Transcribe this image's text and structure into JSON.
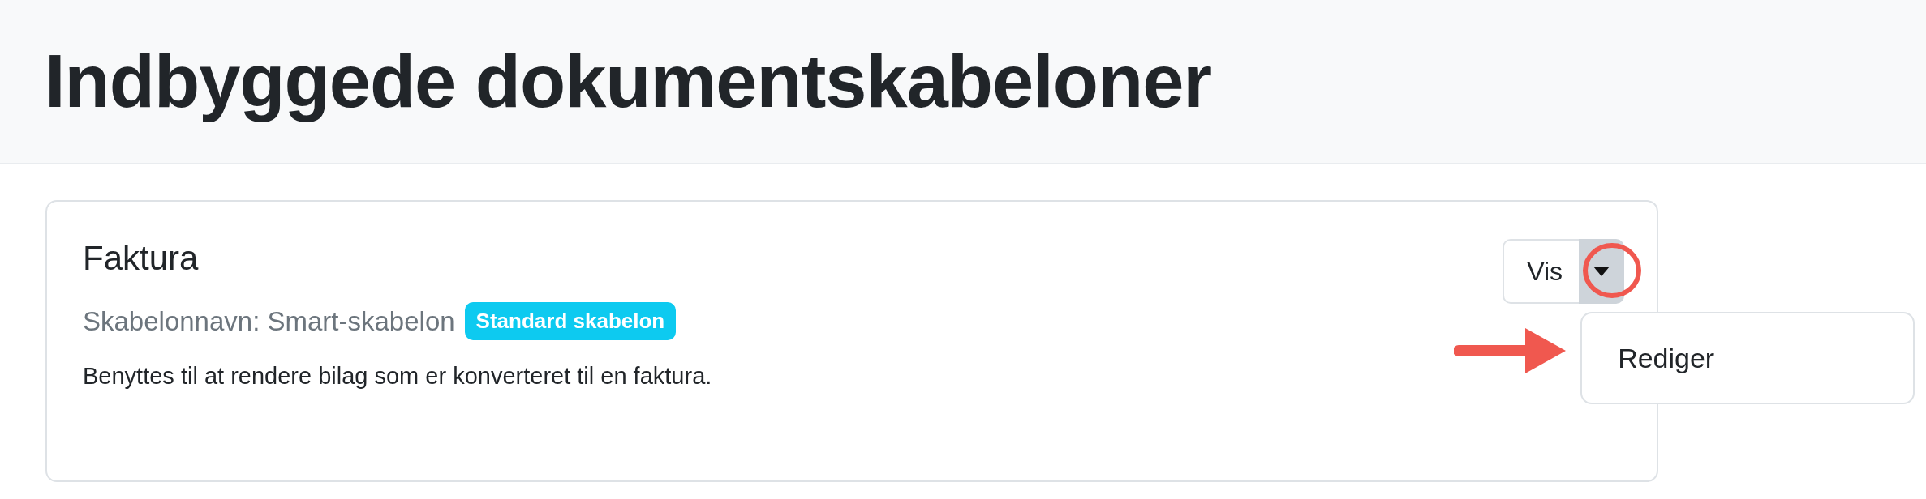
{
  "page_title": "Indbyggede dokumentskabeloner",
  "templates": [
    {
      "title": "Faktura",
      "template_name": "Skabelonnavn: Smart-skabelon",
      "badge": "Standard skabelon",
      "description": "Benyttes til at rendere bilag som er konverteret til en faktura.",
      "action": {
        "label": "Vis",
        "menu_open": true,
        "menu_items": [
          "Rediger"
        ]
      }
    }
  ]
}
